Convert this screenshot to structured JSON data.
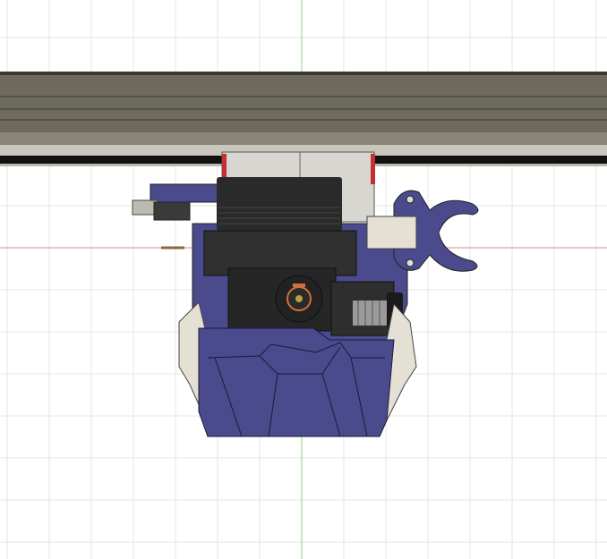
{
  "viewport": {
    "kind": "cad-3d-viewport",
    "view": "front",
    "colors": {
      "background": "#ffffff",
      "grid": "#e4e4e4",
      "x_axis": "#e08a8a",
      "y_axis": "#8fd08f",
      "rail": "#6e6a5e",
      "part_blue": "#4a4a8c",
      "part_black": "#2a2a2a",
      "part_ivory": "#e4e0d4",
      "accent_red": "#c43030",
      "nozzle_orange": "#d0703a"
    }
  },
  "icons": [
    "extrusion-rail",
    "carriage",
    "stepper-motor",
    "hotend-nozzle",
    "cable-clip",
    "fan-duct",
    "spring-screw"
  ]
}
